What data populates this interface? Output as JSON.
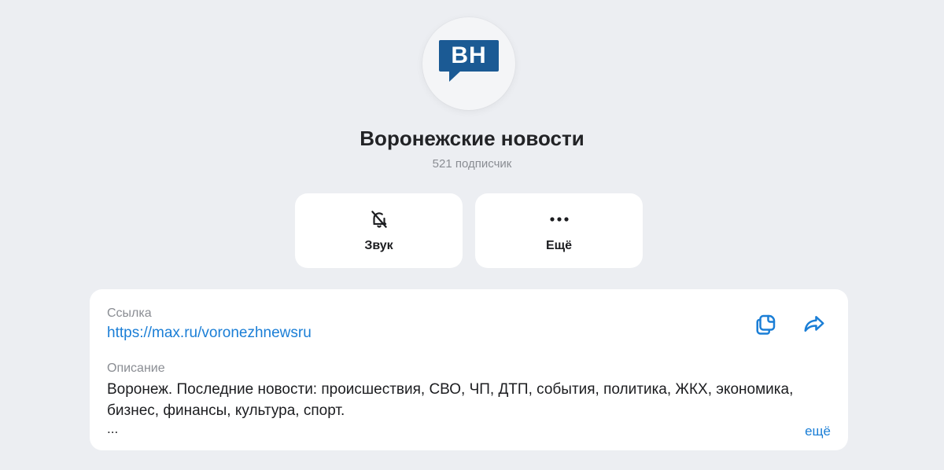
{
  "channel": {
    "avatar_text": "ВН",
    "name": "Воронежские новости",
    "subscribers": "521 подписчик"
  },
  "actions": [
    {
      "label": "Звук",
      "icon": "bell-off-icon"
    },
    {
      "label": "Ещё",
      "icon": "more-dots-icon"
    }
  ],
  "info": {
    "link_label": "Ссылка",
    "link_value": "https://max.ru/voronezhnewsru",
    "description_label": "Описание",
    "description_text": "Воронеж. Последние новости: происшествия, СВО, ЧП, ДТП, события, политика, ЖКХ, экономика, бизнес, финансы, культура, спорт.",
    "description_ellipsis": "...",
    "more_label": "ещё"
  },
  "colors": {
    "background": "#eceef2",
    "card": "#ffffff",
    "accent": "#1a7ed6",
    "logo": "#1b5a94"
  }
}
